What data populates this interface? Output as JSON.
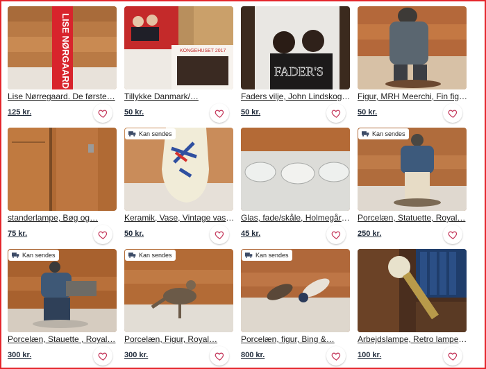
{
  "listings": [
    {
      "title": "Lise Nørregaard. De første…",
      "price": "125 kr.",
      "badge": ""
    },
    {
      "title": "Tillykke Danmark/…",
      "price": "50 kr.",
      "badge": ""
    },
    {
      "title": "Faders vilje, John Lindskog,…",
      "price": "50 kr.",
      "badge": ""
    },
    {
      "title": "Figur, MRH Meerchi, Fin figu…",
      "price": "50 kr.",
      "badge": ""
    },
    {
      "title": "standerlampe, Bøg og…",
      "price": "75 kr.",
      "badge": ""
    },
    {
      "title": "Keramik, Vase, Vintage vase…",
      "price": "50 kr.",
      "badge": "Kan sendes"
    },
    {
      "title": "Glas, fade/skåle, Holmegård…",
      "price": "45 kr.",
      "badge": ""
    },
    {
      "title": "Porcelæn, Statuette, Royal…",
      "price": "250 kr.",
      "badge": "Kan sendes"
    },
    {
      "title": "Porcelæn, Stauette , Royal…",
      "price": "300 kr.",
      "badge": "Kan sendes"
    },
    {
      "title": "Porcelæn, Figur, Royal…",
      "price": "300 kr.",
      "badge": "Kan sendes"
    },
    {
      "title": "Porcelæn, figur, Bing &…",
      "price": "800 kr.",
      "badge": "Kan sendes"
    },
    {
      "title": "Arbejdslampe, Retro lampe,…",
      "price": "100 kr.",
      "badge": ""
    }
  ],
  "photo_texts": {
    "book_spine": "LISE NØRGAARD",
    "book_cover": "KONGEHUSET 2017",
    "fader_title": "FADER'S"
  },
  "icons": {
    "favorite": "heart-icon",
    "shipping": "truck-icon"
  },
  "colors": {
    "border": "#e4262c",
    "price": "#1f2a3a",
    "heart": "#c4365a"
  }
}
